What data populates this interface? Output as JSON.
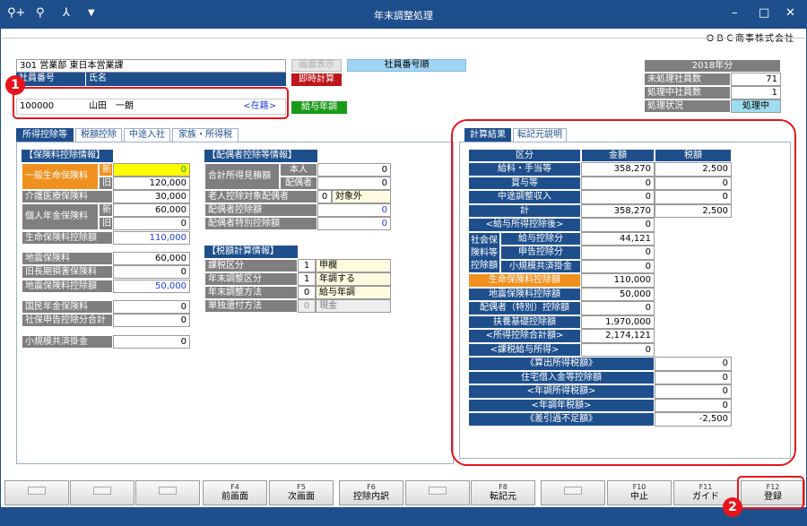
{
  "window": {
    "title": "年末調整処理",
    "company": "ＯＢＣ商事株式会社"
  },
  "toolbar_icons": [
    "search-person-icon",
    "search-doc-icon",
    "filter-icon",
    "dropdown-icon"
  ],
  "employee": {
    "dept": "301 営業部 東日本営業課",
    "id_header": "社員番号",
    "name_header": "氏名",
    "id": "100000",
    "name": "山田　一朗",
    "status": "<在籍>"
  },
  "buttons": {
    "screen_display": "画面表示",
    "employee_order": "社員番号順",
    "instant_calc": "即時計算",
    "salary_adjust": "給与年調"
  },
  "year_info": {
    "year": "2018年分",
    "rows": [
      {
        "label": "未処理社員数",
        "value": "71"
      },
      {
        "label": "処理中社員数",
        "value": "1"
      },
      {
        "label": "処理状況",
        "value": "処理中"
      }
    ]
  },
  "left_tabs": [
    "所得控除等",
    "税額控除",
    "中途入社",
    "家族・所得税"
  ],
  "insurance": {
    "title": "【保険料控除情報】",
    "general_life": "一般生命保険料",
    "new": "新",
    "old": "旧",
    "general_new": "0",
    "general_old": "120,000",
    "nursing": "介護医療保険料",
    "nursing_value": "30,000",
    "pension": "個人年金保険料",
    "pension_new": "60,000",
    "pension_old": "0",
    "life_deduction": "生命保険料控除額",
    "life_deduction_value": "110,000",
    "earthquake": "地震保険料",
    "earthquake_value": "60,000",
    "long_term": "旧長期損害保険料",
    "long_term_value": "0",
    "earthquake_deduction": "地震保険料控除額",
    "earthquake_deduction_value": "50,000",
    "national_pension": "国民年金保険料",
    "national_pension_value": "0",
    "social_total": "社保申告控除分合計",
    "social_total_value": "0",
    "small_biz": "小規模共済掛金",
    "small_biz_value": "0"
  },
  "spouse": {
    "title": "【配偶者控除等情報】",
    "total_income": "合計所得見積額",
    "self": "本人",
    "self_value": "0",
    "spouse": "配偶者",
    "spouse_value": "0",
    "elderly": "老人控除対象配偶者",
    "elderly_code": "0",
    "elderly_text": "対象外",
    "deduction": "配偶者控除額",
    "deduction_value": "0",
    "special": "配偶者特別控除額",
    "special_value": "0"
  },
  "tax_calc": {
    "title": "【税額計算情報】",
    "rows": [
      {
        "label": "課税区分",
        "code": "1",
        "text": "甲欄"
      },
      {
        "label": "年末調整区分",
        "code": "1",
        "text": "年調する"
      },
      {
        "label": "年末調整方法",
        "code": "0",
        "text": "給与年調"
      },
      {
        "label": "単独還付方法",
        "code": "0",
        "text": "現金"
      }
    ]
  },
  "right_tabs": [
    "計算結果",
    "転記元説明"
  ],
  "result": {
    "headers": [
      "区分",
      "金額",
      "税額"
    ],
    "rows": [
      {
        "label": "給料・手当等",
        "amount": "358,270",
        "tax": "2,500"
      },
      {
        "label": "賞与等",
        "amount": "0",
        "tax": "0"
      },
      {
        "label": "中途調整収入",
        "amount": "0",
        "tax": "0"
      },
      {
        "label": "計",
        "amount": "358,270",
        "tax": "2,500"
      },
      {
        "label": "<給与所得控除後>",
        "amount": "0",
        "tax": ""
      }
    ],
    "social_group": "社会保険料等控除額",
    "social_rows": [
      {
        "label": "給与控除分",
        "amount": "44,121"
      },
      {
        "label": "申告控除分",
        "amount": "0"
      },
      {
        "label": "小規模共済掛金",
        "amount": "0"
      }
    ],
    "rows2": [
      {
        "label": "生命保険料控除額",
        "amount": "110,000"
      },
      {
        "label": "地震保険料控除額",
        "amount": "50,000"
      },
      {
        "label": "配偶者（特別）控除額",
        "amount": "0"
      },
      {
        "label": "扶養基礎控除額",
        "amount": "1,970,000"
      },
      {
        "label": "<所得控除合計額>",
        "amount": "2,174,121"
      },
      {
        "label": "<課税給与所得>",
        "amount": "0"
      }
    ],
    "tax_rows": [
      {
        "label": "《算出所得税額》",
        "tax": "0"
      },
      {
        "label": "住宅借入金等控除額",
        "tax": "0"
      },
      {
        "label": "<年調所得税額>",
        "tax": "0"
      },
      {
        "label": "<年調年税額>",
        "tax": "0"
      },
      {
        "label": "《差引過不足額》",
        "tax": "-2,500"
      }
    ]
  },
  "fkeys": [
    {
      "key": "",
      "label": ""
    },
    {
      "key": "",
      "label": ""
    },
    {
      "key": "",
      "label": ""
    },
    {
      "key": "F4",
      "label": "前画面"
    },
    {
      "key": "F5",
      "label": "次画面"
    },
    {
      "key": "F6",
      "label": "控除内訳"
    },
    {
      "key": "",
      "label": ""
    },
    {
      "key": "F8",
      "label": "転記元"
    },
    {
      "key": "",
      "label": ""
    },
    {
      "key": "F10",
      "label": "中止"
    },
    {
      "key": "F11",
      "label": "ガイド"
    },
    {
      "key": "F12",
      "label": "登録"
    }
  ],
  "markers": [
    "1",
    "2"
  ],
  "colors": {
    "primary": "#1e4f8c",
    "highlight_orange": "#f0901e",
    "input_yellow": "#ffff00",
    "accent_red": "#e8141c",
    "green": "#1a9a1a"
  }
}
